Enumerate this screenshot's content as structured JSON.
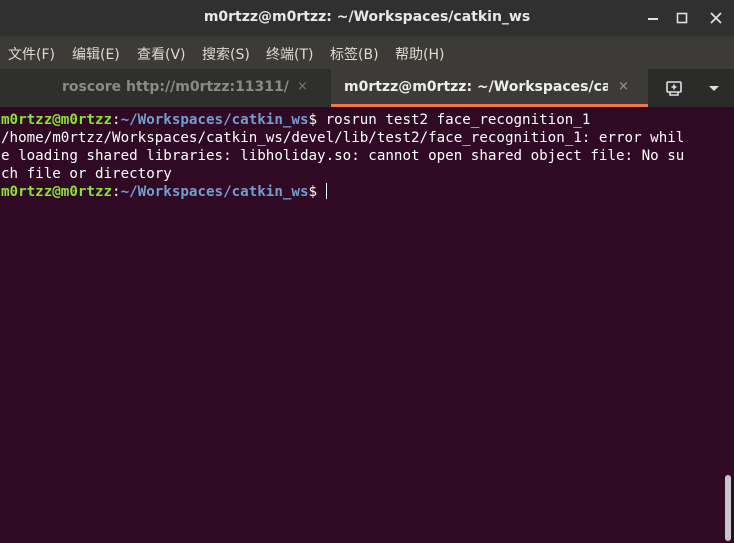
{
  "window": {
    "title": "m0rtzz@m0rtzz: ~/Workspaces/catkin_ws",
    "controls": {
      "minimize": "–",
      "maximize": "□",
      "close": "✕"
    }
  },
  "menu": [
    {
      "label": "文件(F)"
    },
    {
      "label": "编辑(E)"
    },
    {
      "label": "查看(V)"
    },
    {
      "label": "搜索(S)"
    },
    {
      "label": "终端(T)"
    },
    {
      "label": "标签(B)"
    },
    {
      "label": "帮助(H)"
    }
  ],
  "tabs": [
    {
      "label": "roscore http://m0rtzz:11311/",
      "close": "×",
      "active": false
    },
    {
      "label": "m0rtzz@m0rtzz: ~/Workspaces/cat…",
      "close": "×",
      "active": true
    }
  ],
  "tab_actions": {
    "new_tab_icon": "new-tab-icon",
    "menu_icon": "chevron-down-icon"
  },
  "terminal": {
    "prompt1": {
      "user": "m0rtzz@m0rtzz",
      "sep": ":",
      "path": "~/Workspaces/catkin_ws",
      "sym": "$",
      "cmd": " rosrun test2 face_recognition_1"
    },
    "output": [
      "/home/m0rtzz/Workspaces/catkin_ws/devel/lib/test2/face_recognition_1: error whil",
      "e loading shared libraries: libholiday.so: cannot open shared object file: No su",
      "ch file or directory"
    ],
    "prompt2": {
      "user": "m0rtzz@m0rtzz",
      "sep": ":",
      "path": "~/Workspaces/catkin_ws",
      "sym": "$",
      "cmd": " "
    }
  },
  "colors": {
    "terminal_bg": "#300a24",
    "prompt_user": "#8ae234",
    "prompt_path": "#729fcf",
    "active_tab_accent": "#f07746"
  }
}
